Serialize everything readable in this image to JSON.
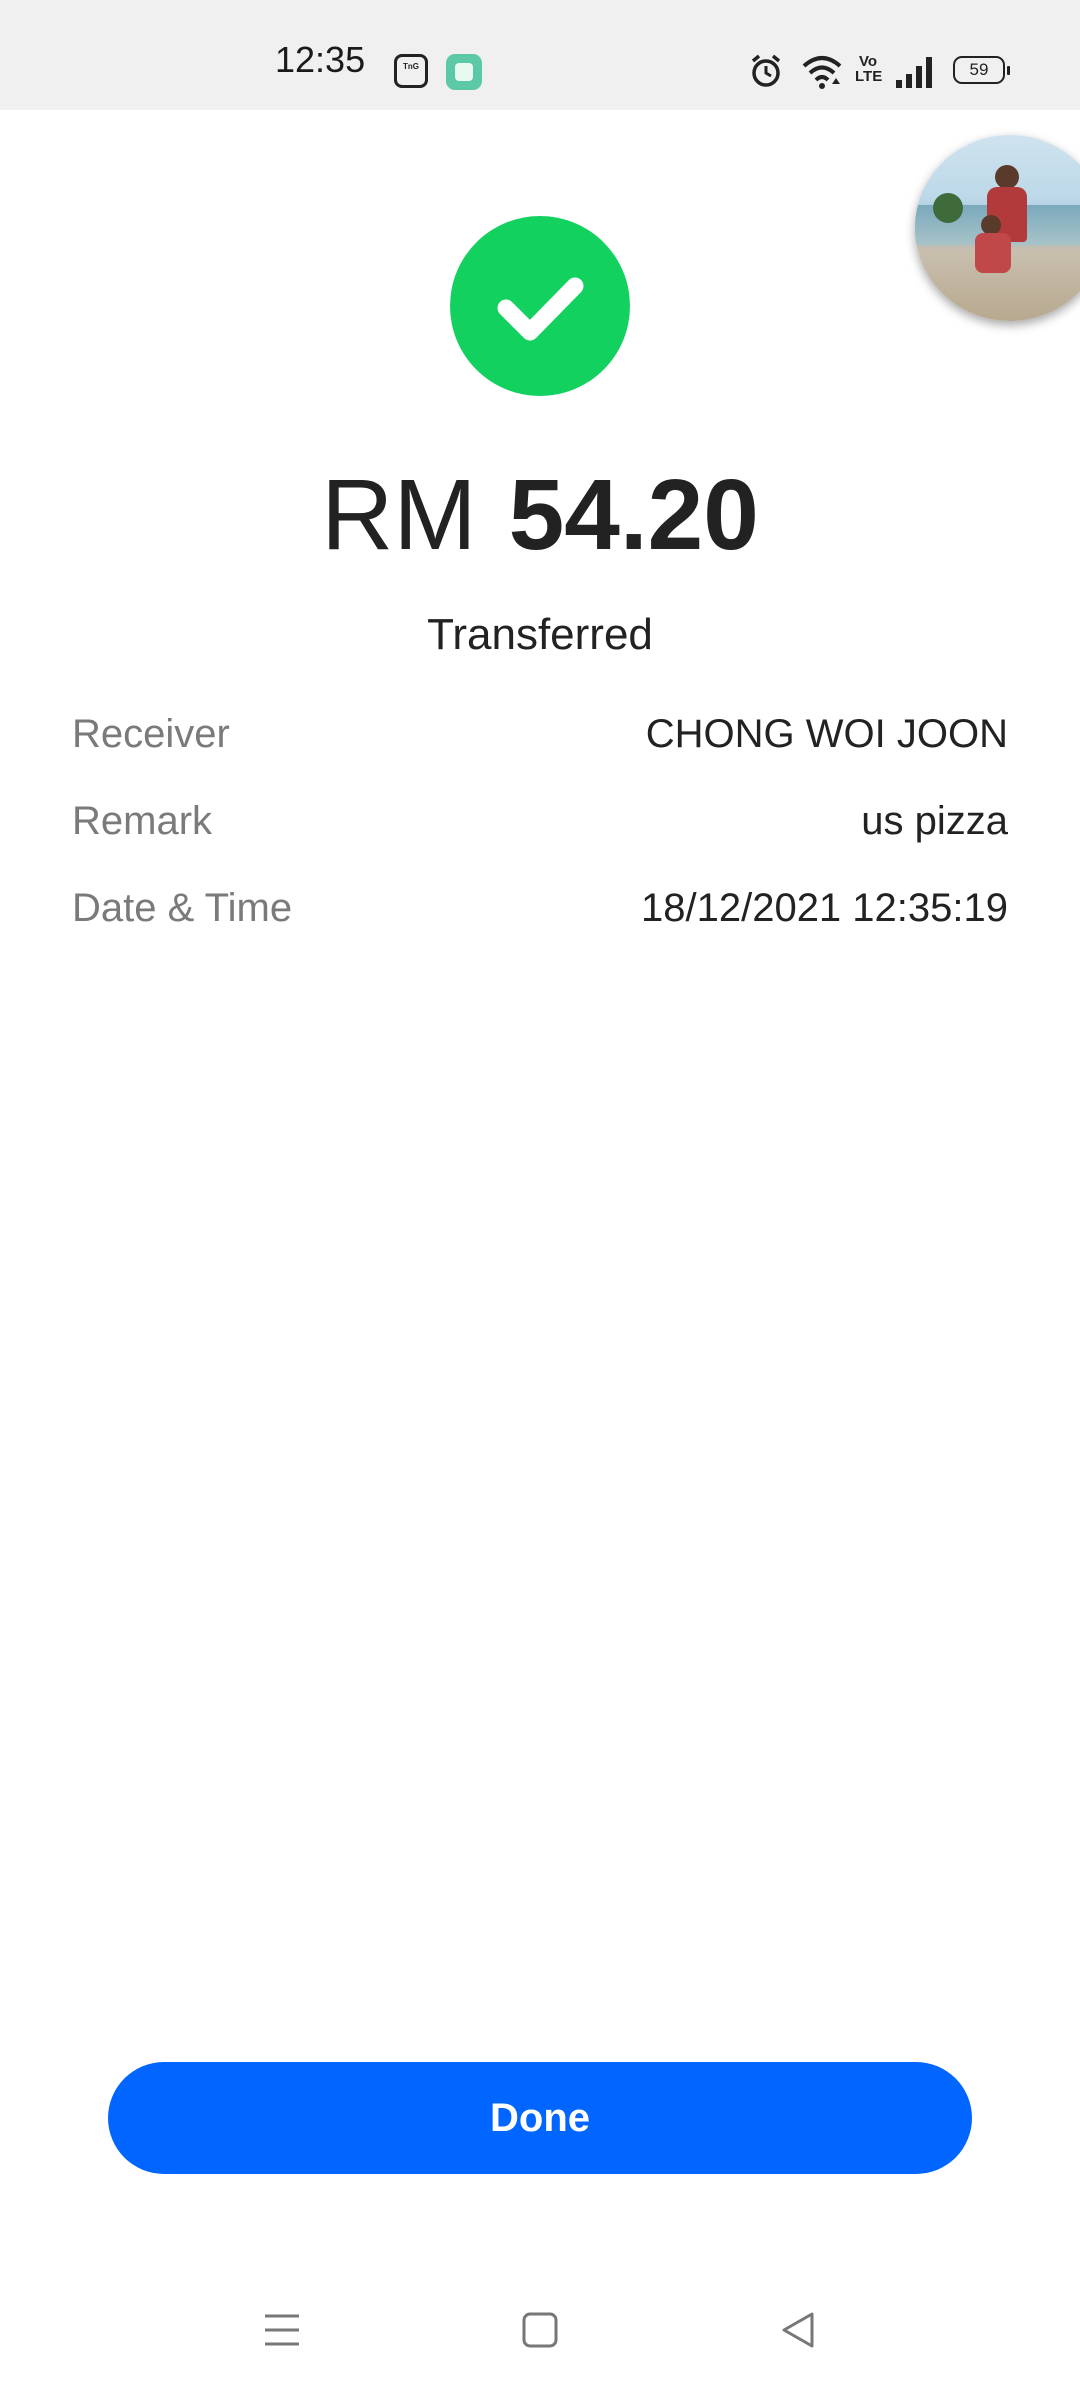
{
  "status_bar": {
    "time": "12:35",
    "app_icon_text": "Touch 'n Go eWallet",
    "volte": "Vo LTE",
    "battery": "59",
    "icons": [
      "touchngo-icon",
      "app-icon",
      "alarm-icon",
      "wifi-icon",
      "volte-icon",
      "signal-icon",
      "battery-icon"
    ]
  },
  "receipt": {
    "currency": "RM",
    "amount": "54.20",
    "status": "Transferred",
    "status_color": "#13d15f",
    "details": [
      {
        "label": "Receiver",
        "value": "CHONG WOI JOON"
      },
      {
        "label": "Remark",
        "value": "us pizza"
      },
      {
        "label": "Date & Time",
        "value": "18/12/2021 12:35:19"
      }
    ]
  },
  "actions": {
    "done_label": "Done",
    "accent_color": "#0066ff"
  },
  "nav_bar": {
    "icons": [
      "menu-icon",
      "home-icon",
      "back-icon"
    ]
  }
}
